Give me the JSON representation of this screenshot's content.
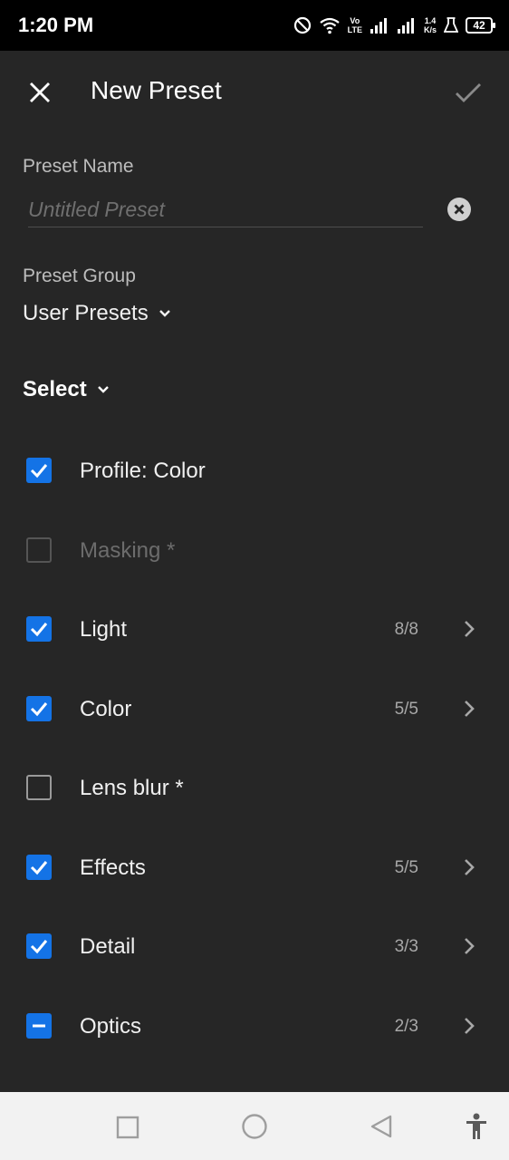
{
  "status_bar": {
    "time": "1:20 PM",
    "volte_top": "Vo",
    "volte_bottom": "LTE",
    "net_speed_value": "1.4",
    "net_speed_unit": "K/s",
    "battery": "42"
  },
  "header": {
    "title": "New Preset",
    "close_icon": "close-icon",
    "confirm_icon": "checkmark-icon"
  },
  "preset_name": {
    "label": "Preset Name",
    "value": "",
    "placeholder": "Untitled Preset"
  },
  "preset_group": {
    "label": "Preset Group",
    "value": "User Presets"
  },
  "select_menu": {
    "label": "Select"
  },
  "items": [
    {
      "label": "Profile: Color",
      "state": "checked",
      "count": "",
      "has_chevron": false
    },
    {
      "label": "Masking *",
      "state": "disabled",
      "count": "",
      "has_chevron": false
    },
    {
      "label": "Light",
      "state": "checked",
      "count": "8/8",
      "has_chevron": true
    },
    {
      "label": "Color",
      "state": "checked",
      "count": "5/5",
      "has_chevron": true
    },
    {
      "label": "Lens blur *",
      "state": "unchecked",
      "count": "",
      "has_chevron": false
    },
    {
      "label": "Effects",
      "state": "checked",
      "count": "5/5",
      "has_chevron": true
    },
    {
      "label": "Detail",
      "state": "checked",
      "count": "3/3",
      "has_chevron": true
    },
    {
      "label": "Optics",
      "state": "partial",
      "count": "2/3",
      "has_chevron": true
    }
  ],
  "colors": {
    "accent": "#1473e6",
    "background": "#262626",
    "nav_bar": "#f2f2f2"
  },
  "nav_bar": {
    "icons": [
      "recents-square-icon",
      "home-circle-icon",
      "back-triangle-icon",
      "accessibility-icon"
    ]
  }
}
